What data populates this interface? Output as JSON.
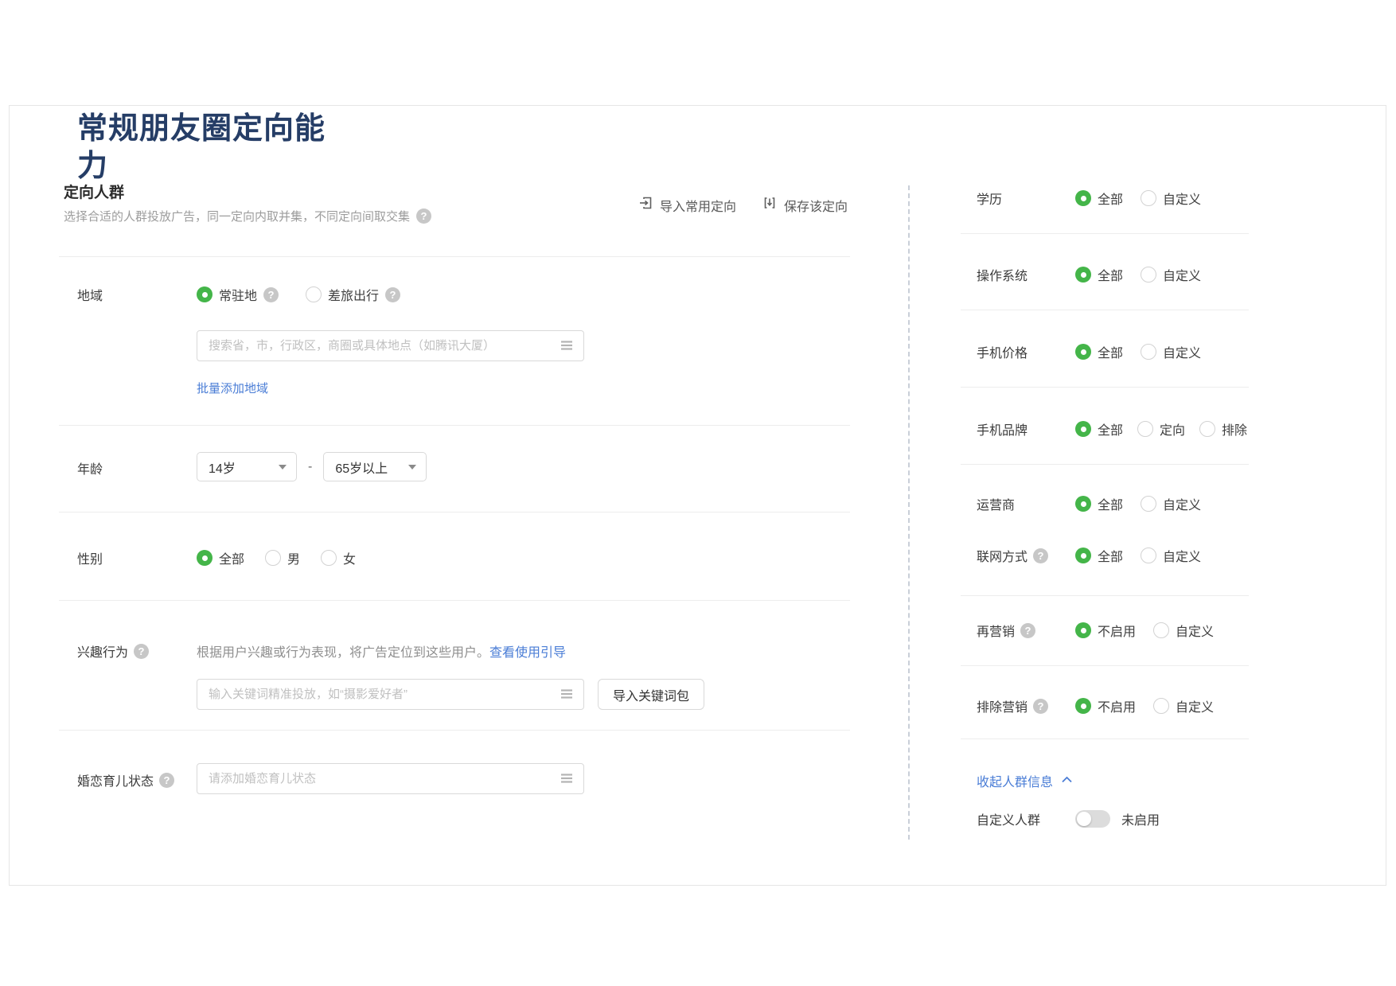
{
  "title": "常规朋友圈定向能力",
  "colors": {
    "accent_green": "#44b549",
    "link_blue": "#4a7dd6",
    "title_navy": "#253d66"
  },
  "audience": {
    "section_title": "定向人群",
    "section_subtitle": "选择合适的人群投放广告，同一定向内取并集，不同定向间取交集",
    "import_action": "导入常用定向",
    "save_action": "保存该定向",
    "region": {
      "label": "地域",
      "resident_option": "常驻地",
      "travel_option": "差旅出行",
      "search_placeholder": "搜索省，市，行政区，商圈或具体地点（如腾讯大厦）",
      "batch_add_link": "批量添加地域"
    },
    "age": {
      "label": "年龄",
      "from_value": "14岁",
      "range_dash": "-",
      "to_value": "65岁以上"
    },
    "gender": {
      "label": "性别",
      "all_option": "全部",
      "male_option": "男",
      "female_option": "女"
    },
    "interest": {
      "label": "兴趣行为",
      "description": "根据用户兴趣或行为表现，将广告定位到这些用户。",
      "guide_link": "查看使用引导",
      "keyword_placeholder": "输入关键词精准投放，如“摄影爱好者”",
      "import_package_button": "导入关键词包"
    },
    "marital": {
      "label": "婚恋育儿状态",
      "placeholder": "请添加婚恋育儿状态"
    }
  },
  "device": {
    "rows": [
      {
        "label": "学历",
        "options": [
          {
            "label": "全部",
            "selected": true
          },
          {
            "label": "自定义",
            "selected": false
          }
        ]
      },
      {
        "label": "操作系统",
        "options": [
          {
            "label": "全部",
            "selected": true
          },
          {
            "label": "自定义",
            "selected": false
          }
        ]
      },
      {
        "label": "手机价格",
        "options": [
          {
            "label": "全部",
            "selected": true
          },
          {
            "label": "自定义",
            "selected": false
          }
        ]
      },
      {
        "label": "手机品牌",
        "options": [
          {
            "label": "全部",
            "selected": true
          },
          {
            "label": "定向",
            "selected": false
          },
          {
            "label": "排除",
            "selected": false
          }
        ]
      },
      {
        "label": "运营商",
        "options": [
          {
            "label": "全部",
            "selected": true
          },
          {
            "label": "自定义",
            "selected": false
          }
        ]
      },
      {
        "label": "联网方式",
        "help": true,
        "options": [
          {
            "label": "全部",
            "selected": true
          },
          {
            "label": "自定义",
            "selected": false
          }
        ]
      },
      {
        "label": "再营销",
        "help": true,
        "options": [
          {
            "label": "不启用",
            "selected": true
          },
          {
            "label": "自定义",
            "selected": false
          }
        ]
      },
      {
        "label": "排除营销",
        "help": true,
        "options": [
          {
            "label": "不启用",
            "selected": true
          },
          {
            "label": "自定义",
            "selected": false
          }
        ]
      }
    ],
    "collapse_link": "收起人群信息",
    "custom_audience_label": "自定义人群",
    "custom_audience_state": "未启用"
  }
}
